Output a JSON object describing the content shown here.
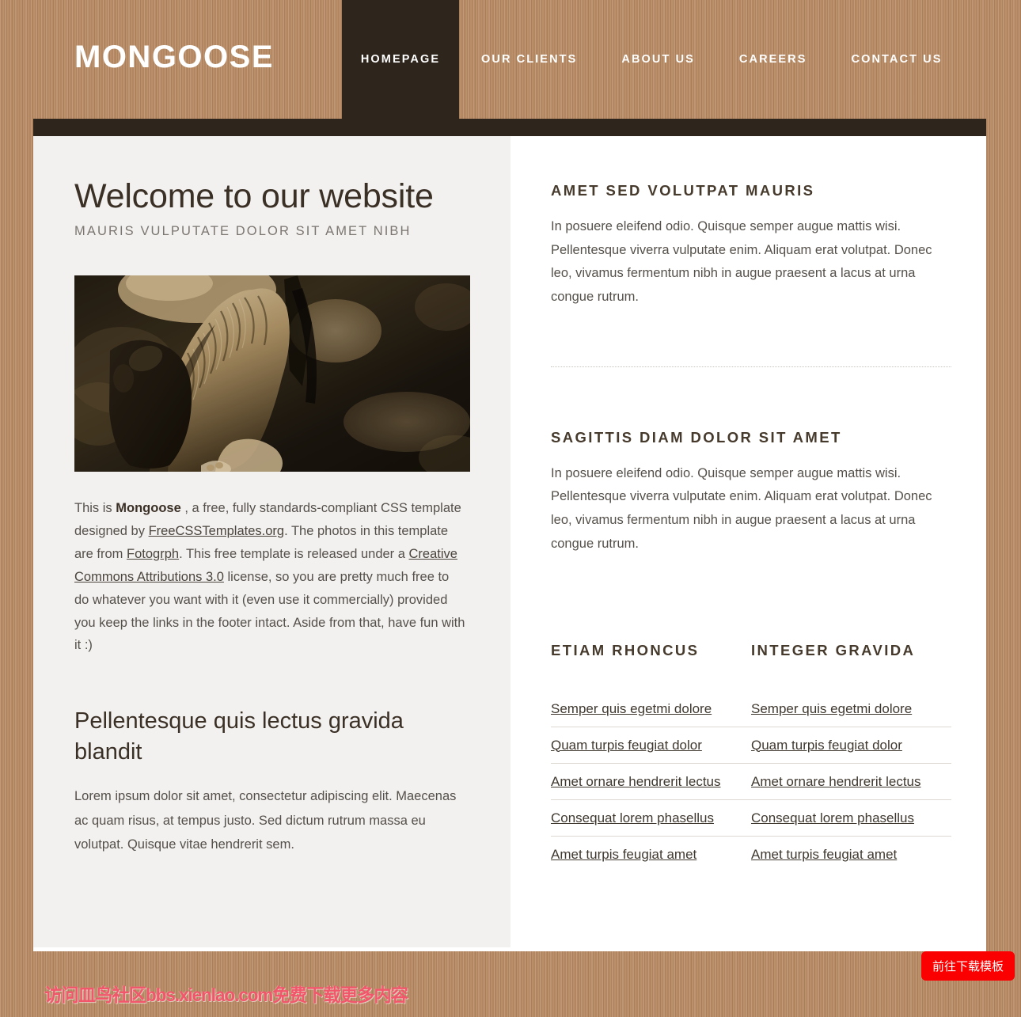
{
  "site": {
    "logo": "MONGOOSE",
    "colors": {
      "wood": "#b78a63",
      "dark": "#2e251c",
      "left_panel": "#f2f1f0",
      "heading": "#3b3025",
      "body_text": "#55504a",
      "accent_button": "#fa0000",
      "watermark": "#f2566b"
    }
  },
  "nav": {
    "items": [
      {
        "label": "HOMEPAGE",
        "active": true
      },
      {
        "label": "OUR CLIENTS",
        "active": false
      },
      {
        "label": "ABOUT US",
        "active": false
      },
      {
        "label": "CAREERS",
        "active": false
      },
      {
        "label": "CONTACT US",
        "active": false
      }
    ]
  },
  "main": {
    "title": "Welcome to our website",
    "subtitle": "MAURIS VULPUTATE DOLOR SIT AMET NIBH",
    "photo_alt": "mongoose-photo",
    "intro": {
      "part1": "This is ",
      "brand": "Mongoose",
      "part2": " , a free, fully standards-compliant CSS template designed by ",
      "link1": "FreeCSSTemplates.org",
      "part3": ". The photos in this template are from ",
      "link2": "Fotogrph",
      "part4": ". This free template is released under a ",
      "link3": "Creative Commons Attributions 3.0",
      "part5": " license, so you are pretty much free to do whatever you want with it (even use it commercially) provided you keep the links in the footer intact. Aside from that, have fun with it :)"
    },
    "section2_title": "Pellentesque quis lectus gravida blandit",
    "section2_text": "Lorem ipsum dolor sit amet, consectetur adipiscing elit. Maecenas ac quam risus, at tempus justo. Sed dictum rutrum massa eu volutpat. Quisque vitae hendrerit sem."
  },
  "sidebar": {
    "block1": {
      "title": "AMET SED VOLUTPAT MAURIS",
      "text": "In posuere eleifend odio. Quisque semper augue mattis wisi. Pellentesque viverra vulputate enim. Aliquam erat volutpat. Donec leo, vivamus fermentum nibh in augue praesent a lacus at urna congue rutrum."
    },
    "block2": {
      "title": "SAGITTIS DIAM DOLOR SIT AMET",
      "text": "In posuere eleifend odio. Quisque semper augue mattis wisi. Pellentesque viverra vulputate enim. Aliquam erat volutpat. Donec leo, vivamus fermentum nibh in augue praesent a lacus at urna congue rutrum."
    },
    "list_columns": [
      {
        "title": "ETIAM RHONCUS",
        "items": [
          "Semper quis egetmi dolore",
          "Quam turpis feugiat dolor",
          "Amet ornare hendrerit lectus",
          "Consequat lorem phasellus",
          "Amet turpis feugiat amet"
        ]
      },
      {
        "title": "INTEGER GRAVIDA",
        "items": [
          "Semper quis egetmi dolore",
          "Quam turpis feugiat dolor",
          "Amet ornare hendrerit lectus",
          "Consequat lorem phasellus",
          "Amet turpis feugiat amet"
        ]
      }
    ]
  },
  "overlay": {
    "watermark": "访问皿鸟社区bbs.xienlao.com免费下载更多内容",
    "download_button": "前往下载模板"
  }
}
